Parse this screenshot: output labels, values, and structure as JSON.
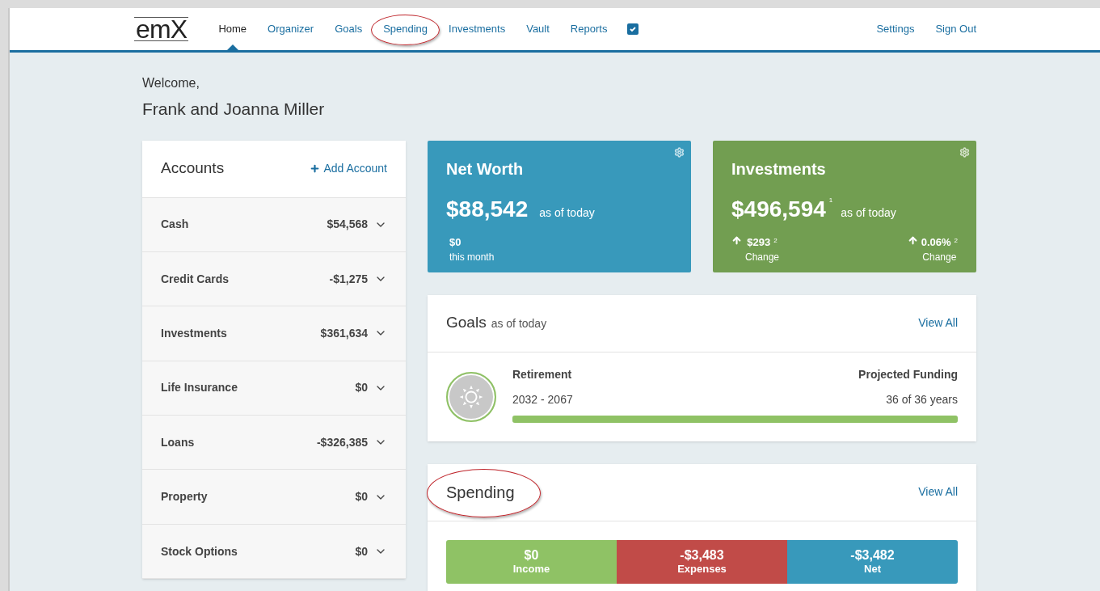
{
  "nav": {
    "logo": "emX",
    "items": [
      {
        "label": "Home",
        "selected": true,
        "highlighted": false
      },
      {
        "label": "Organizer",
        "selected": false,
        "highlighted": false
      },
      {
        "label": "Goals",
        "selected": false,
        "highlighted": false
      },
      {
        "label": "Spending",
        "selected": false,
        "highlighted": true
      },
      {
        "label": "Investments",
        "selected": false,
        "highlighted": false
      },
      {
        "label": "Vault",
        "selected": false,
        "highlighted": false
      },
      {
        "label": "Reports",
        "selected": false,
        "highlighted": false
      }
    ],
    "right_items": [
      "Settings",
      "Sign Out"
    ]
  },
  "welcome": {
    "greeting": "Welcome,",
    "name": "Frank and Joanna Miller"
  },
  "accounts": {
    "title": "Accounts",
    "add": "Add Account",
    "rows": [
      {
        "name": "Cash",
        "amount": "$54,568"
      },
      {
        "name": "Credit Cards",
        "amount": "-$1,275"
      },
      {
        "name": "Investments",
        "amount": "$361,634"
      },
      {
        "name": "Life Insurance",
        "amount": "$0"
      },
      {
        "name": "Loans",
        "amount": "-$326,385"
      },
      {
        "name": "Property",
        "amount": "$0"
      },
      {
        "name": "Stock Options",
        "amount": "$0"
      }
    ]
  },
  "net_worth": {
    "title": "Net Worth",
    "value": "$88,542",
    "as_of": "as of today",
    "change": "$0",
    "change_label": "this month"
  },
  "investments": {
    "title": "Investments",
    "value": "$496,594",
    "value_note": "1",
    "as_of": "as of today",
    "changes": [
      {
        "value": "$293",
        "note": "2",
        "label": "Change"
      },
      {
        "value": "0.06%",
        "note": "2",
        "label": "Change"
      }
    ]
  },
  "goals": {
    "title": "Goals",
    "subtitle": "as of today",
    "view_all": "View All",
    "goal": {
      "name": "Retirement",
      "years": "2032 - 2067",
      "funding_label": "Projected Funding",
      "funding": "36 of 36 years",
      "level": 1
    }
  },
  "spending": {
    "title": "Spending",
    "highlighted": true,
    "view_all": "View All",
    "segments": [
      {
        "value": "$0",
        "label": "Income",
        "color": "#8fc265"
      },
      {
        "value": "-$3,483",
        "label": "Expenses",
        "color": "#c14b48"
      },
      {
        "value": "-$3,482",
        "label": "Net",
        "color": "#3899bb"
      }
    ]
  }
}
